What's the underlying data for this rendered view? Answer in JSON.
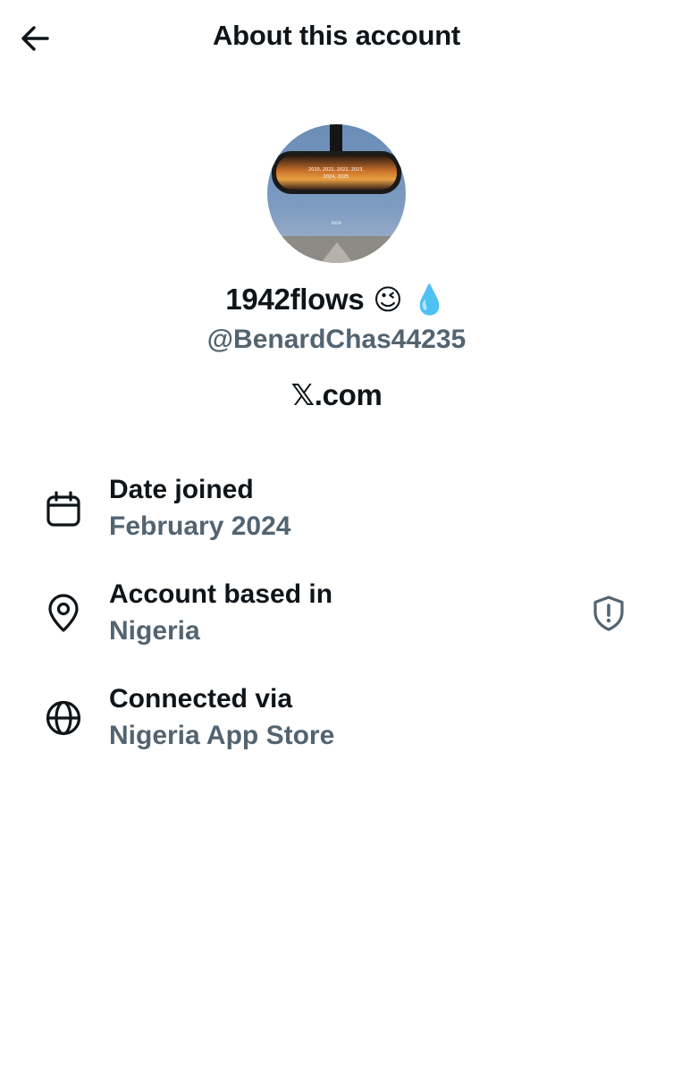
{
  "header": {
    "title": "About this account",
    "back_icon": "arrow-left-icon"
  },
  "profile": {
    "avatar": {
      "years_text_line1": "2020, 2021, 2022, 2023,",
      "years_text_line2": "2024, 2025",
      "bottom_text": "2029"
    },
    "display_name": "1942flows",
    "name_emojis": [
      "😉",
      "💧"
    ],
    "handle": "@BenardChas44235",
    "site": {
      "logo": "𝕏",
      "suffix": ".com"
    }
  },
  "details": [
    {
      "icon": "calendar-icon",
      "label": "Date joined",
      "value": "February 2024"
    },
    {
      "icon": "location-pin-icon",
      "label": "Account based in",
      "value": "Nigeria",
      "action_icon": "shield-alert-icon"
    },
    {
      "icon": "globe-icon",
      "label": "Connected via",
      "value": "Nigeria App Store"
    }
  ],
  "colors": {
    "primary_text": "#0f1419",
    "secondary_text": "#536471",
    "background": "#ffffff"
  }
}
